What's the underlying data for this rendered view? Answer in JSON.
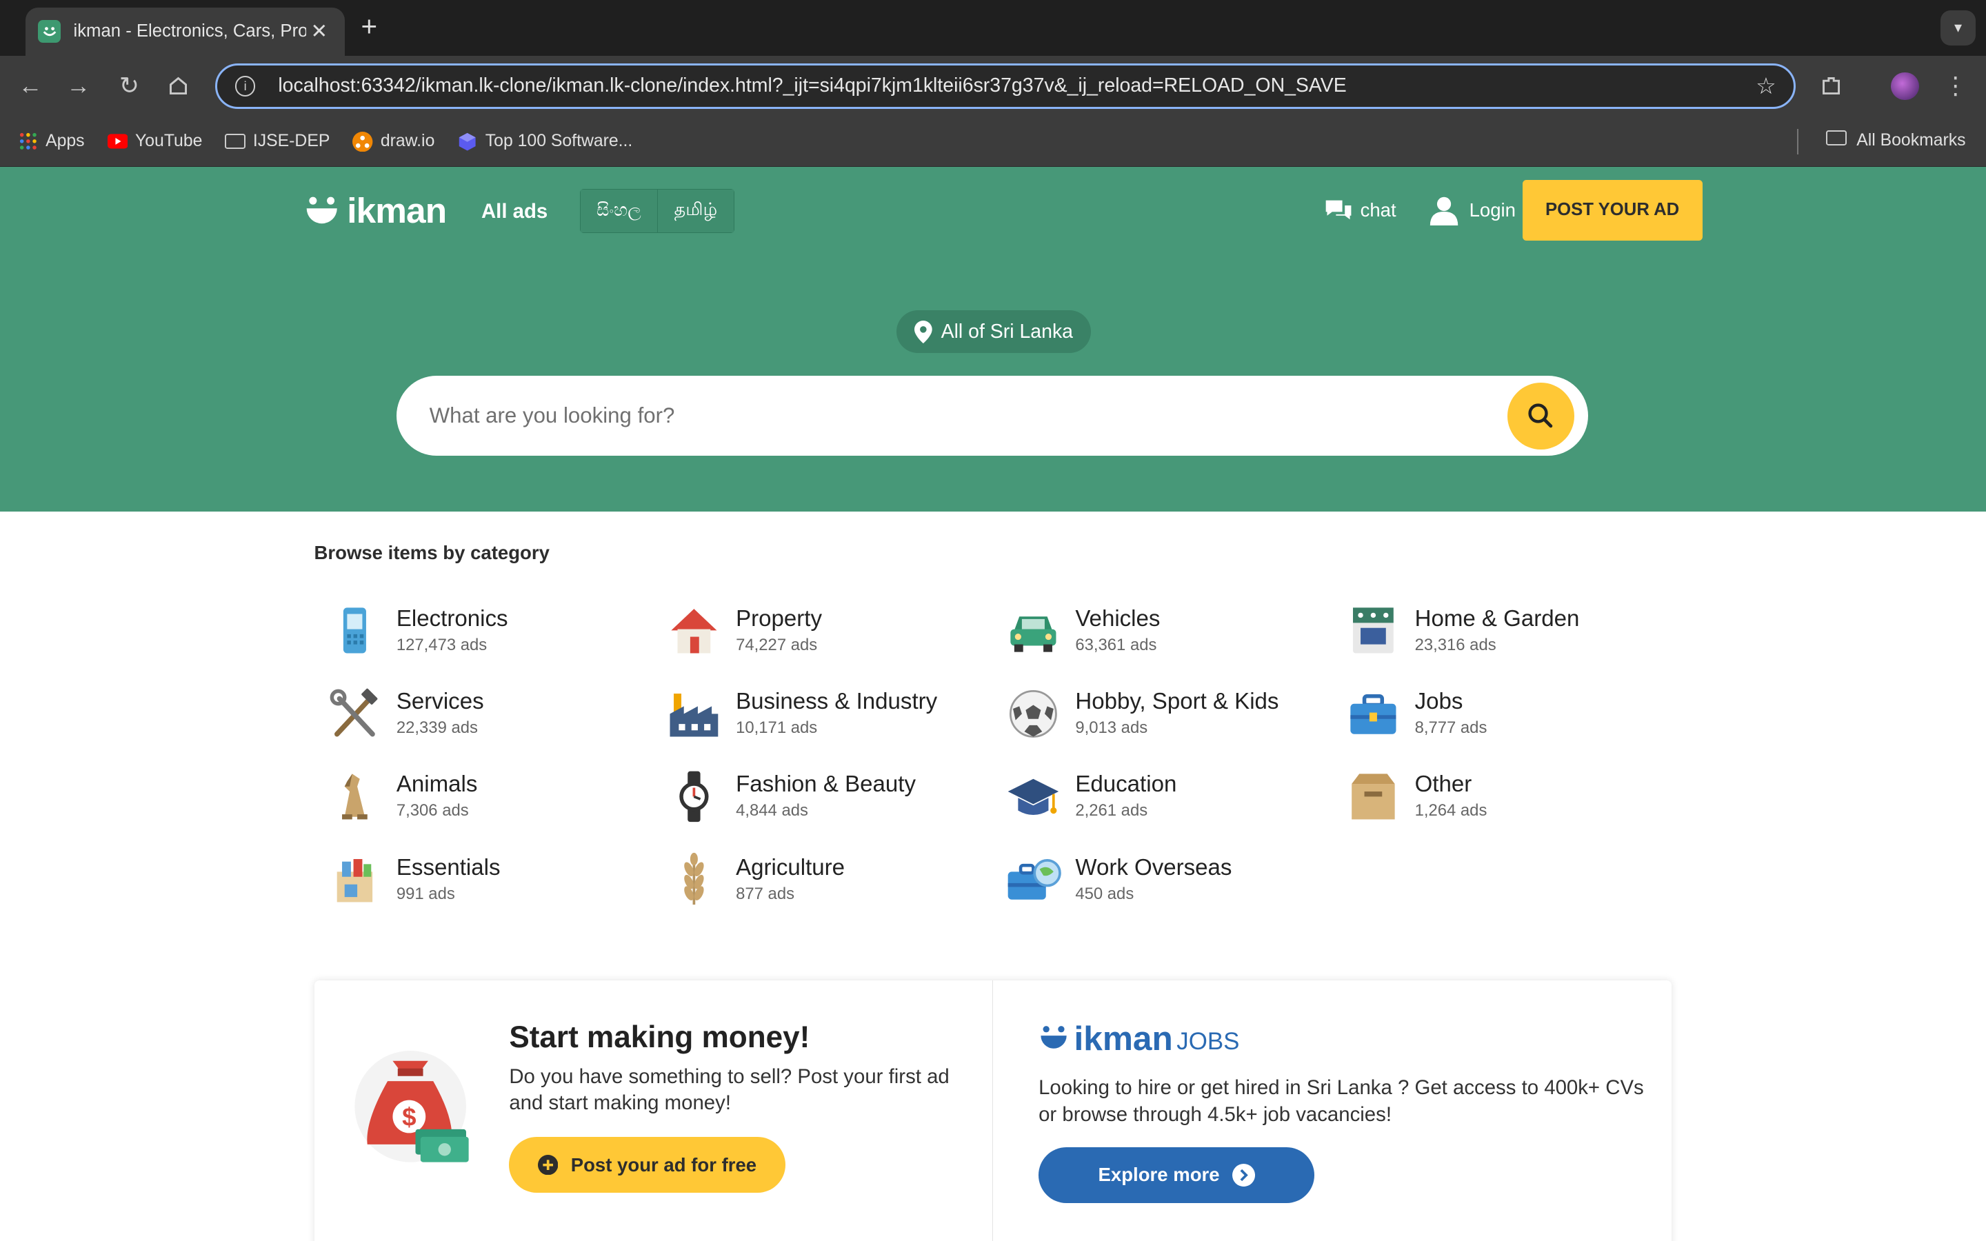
{
  "browser": {
    "tab_title": "ikman - Electronics, Cars, Pro",
    "url": "localhost:63342/ikman.lk-clone/ikman.lk-clone/index.html?_ijt=si4qpi7kjm1klteii6sr37g37v&_ij_reload=RELOAD_ON_SAVE",
    "bookmarks": [
      "Apps",
      "YouTube",
      "IJSE-DEP",
      "draw.io",
      "Top 100 Software..."
    ],
    "all_bookmarks": "All Bookmarks"
  },
  "header": {
    "logo_text": "ikman",
    "all_ads": "All ads",
    "lang_sinhala": "සිංහල",
    "lang_tamil": "தமிழ்",
    "chat": "chat",
    "login": "Login",
    "post_ad": "POST YOUR AD",
    "location": "All of Sri Lanka",
    "search_placeholder": "What are you looking for?",
    "brand_color": "#479878",
    "accent_color": "#ffc836"
  },
  "browse": {
    "title": "Browse items by category",
    "categories": [
      {
        "name": "Electronics",
        "count": "127,473 ads",
        "icon": "phone-icon"
      },
      {
        "name": "Property",
        "count": "74,227 ads",
        "icon": "house-icon"
      },
      {
        "name": "Vehicles",
        "count": "63,361 ads",
        "icon": "car-icon"
      },
      {
        "name": "Home & Garden",
        "count": "23,316 ads",
        "icon": "stove-icon"
      },
      {
        "name": "Services",
        "count": "22,339 ads",
        "icon": "tools-icon"
      },
      {
        "name": "Business & Industry",
        "count": "10,171 ads",
        "icon": "factory-icon"
      },
      {
        "name": "Hobby, Sport & Kids",
        "count": "9,013 ads",
        "icon": "football-icon"
      },
      {
        "name": "Jobs",
        "count": "8,777 ads",
        "icon": "briefcase-icon"
      },
      {
        "name": "Animals",
        "count": "7,306 ads",
        "icon": "dog-icon"
      },
      {
        "name": "Fashion & Beauty",
        "count": "4,844 ads",
        "icon": "watch-icon"
      },
      {
        "name": "Education",
        "count": "2,261 ads",
        "icon": "graduation-cap-icon"
      },
      {
        "name": "Other",
        "count": "1,264 ads",
        "icon": "box-icon"
      },
      {
        "name": "Essentials",
        "count": "991 ads",
        "icon": "grocery-bag-icon"
      },
      {
        "name": "Agriculture",
        "count": "877 ads",
        "icon": "wheat-icon"
      },
      {
        "name": "Work Overseas",
        "count": "450 ads",
        "icon": "suitcase-globe-icon"
      }
    ]
  },
  "promo": {
    "title": "Start making money!",
    "text": "Do you have something to sell? Post your first ad and start making money!",
    "button": "Post your ad for free"
  },
  "jobs": {
    "logo_main": "ikman",
    "logo_sub": "JOBS",
    "text": "Looking to hire or get hired in Sri Lanka ? Get access to 400k+ CVs or browse through 4.5k+ job vacancies!",
    "button": "Explore more"
  }
}
